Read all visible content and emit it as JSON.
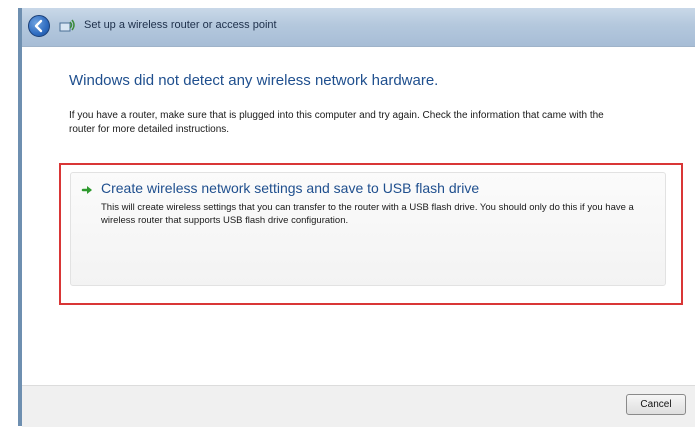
{
  "window": {
    "title": "Set up a wireless router or access point"
  },
  "main": {
    "heading": "Windows did not detect any wireless network hardware.",
    "info_text": "If you have a router, make sure that is plugged into this computer and try again. Check the information that came with the router for more detailed instructions.",
    "option": {
      "title": "Create wireless network settings and save to USB flash drive",
      "description": "This will create wireless settings that you can transfer to the router with a USB flash drive. You should only do this if you have a wireless router that supports USB flash drive configuration.",
      "icon": "green-arrow-icon"
    },
    "highlight_color": "#d93636"
  },
  "footer": {
    "cancel_label": "Cancel"
  },
  "colors": {
    "heading": "#1f4f8e",
    "titlebar": "#b4c8dd"
  }
}
